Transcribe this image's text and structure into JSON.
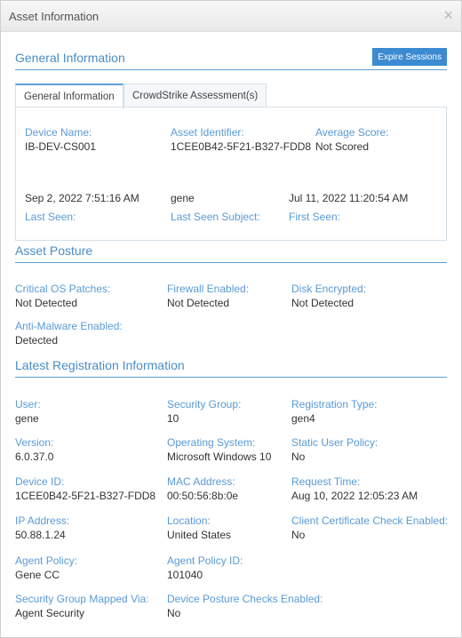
{
  "dialog": {
    "title": "Asset Information",
    "close_icon": "×"
  },
  "general": {
    "heading": "General Information",
    "expire_button": "Expire Sessions",
    "tabs": [
      {
        "label": "General Information",
        "active": true
      },
      {
        "label": "CrowdStrike Assessment(s)",
        "active": false
      }
    ],
    "fields_top": [
      {
        "label": "Device Name:",
        "value": "IB-DEV-CS001"
      },
      {
        "label": "Asset Identifier:",
        "value": "1CEE0B42-5F21-B327-FDD8"
      },
      {
        "label": "Average Score:",
        "value": "Not Scored"
      }
    ],
    "fields_bottom": [
      {
        "label": "Last Seen:",
        "value": "Sep 2, 2022 7:51:16 AM"
      },
      {
        "label": "Last Seen Subject:",
        "value": "gene"
      },
      {
        "label": "First Seen:",
        "value": "Jul 11, 2022 11:20:54 AM"
      }
    ]
  },
  "posture": {
    "heading": "Asset Posture",
    "fields": [
      {
        "label": "Critical OS Patches:",
        "value": "Not Detected"
      },
      {
        "label": "Firewall Enabled:",
        "value": "Not Detected"
      },
      {
        "label": "Disk Encrypted:",
        "value": "Not Detected"
      },
      {
        "label": "Anti-Malware Enabled:",
        "value": "Detected"
      }
    ]
  },
  "registration": {
    "heading": "Latest Registration Information",
    "fields": [
      {
        "label": "User:",
        "value": "gene"
      },
      {
        "label": "Security Group:",
        "value": "10"
      },
      {
        "label": "Registration Type:",
        "value": "gen4"
      },
      {
        "label": "Version:",
        "value": "6.0.37.0"
      },
      {
        "label": "Operating System:",
        "value": "Microsoft Windows 10"
      },
      {
        "label": "Static User Policy:",
        "value": "No"
      },
      {
        "label": "Device ID:",
        "value": "1CEE0B42-5F21-B327-FDD8"
      },
      {
        "label": "MAC Address:",
        "value": "00:50:56:8b:0e"
      },
      {
        "label": "Request Time:",
        "value": "Aug 10, 2022 12:05:23 AM"
      },
      {
        "label": "IP Address:",
        "value": "50.88.1.24"
      },
      {
        "label": "Location:",
        "value": "United States"
      },
      {
        "label": "Client Certificate Check Enabled:",
        "value": "No"
      },
      {
        "label": "Agent Policy:",
        "value": "Gene CC"
      },
      {
        "label": "Agent Policy ID:",
        "value": "101040"
      },
      {
        "label": "Security Group Mapped Via:",
        "value": "Agent Security"
      },
      {
        "label": "Device Posture Checks Enabled:",
        "value": "No"
      }
    ]
  },
  "colors": {
    "accent": "#4a8cc6",
    "label": "#5a9ad5",
    "button": "#3b8ad2"
  }
}
